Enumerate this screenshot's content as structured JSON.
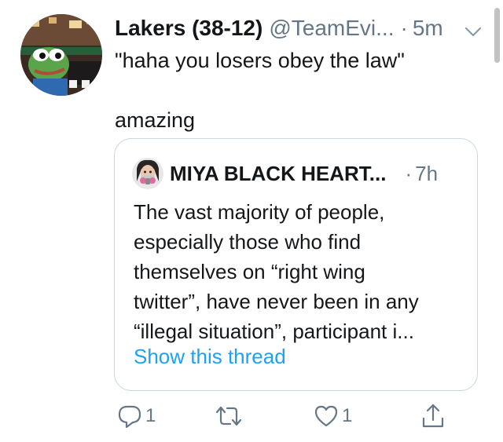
{
  "tweet": {
    "display_name": "Lakers (38-12)",
    "handle": "@TeamEvi...",
    "separator": "·",
    "time": "5m",
    "text_line1": "\"haha you losers obey the law\"",
    "text_line2": "amazing",
    "avatar_icon": "pepe-frog-avatar",
    "caret_icon": "chevron-down-icon"
  },
  "quote": {
    "display_name": "MIYA BLACK HEART...",
    "separator": "·",
    "time": "7h",
    "avatar_icon": "gas-mask-avatar",
    "text_lines": [
      "The vast majority of people,",
      "especially those who find",
      "themselves on “right wing",
      "twitter”, have never been in any",
      "“illegal situation”, participant i..."
    ],
    "show_thread": "Show this thread"
  },
  "actions": {
    "reply_count": "1",
    "retweet_count": "",
    "like_count": "1",
    "reply_icon": "reply-icon",
    "retweet_icon": "retweet-icon",
    "like_icon": "heart-icon",
    "share_icon": "share-icon"
  },
  "colors": {
    "text": "#14171a",
    "secondary": "#657786",
    "link": "#1da1f2",
    "border": "#ccd6dd"
  }
}
